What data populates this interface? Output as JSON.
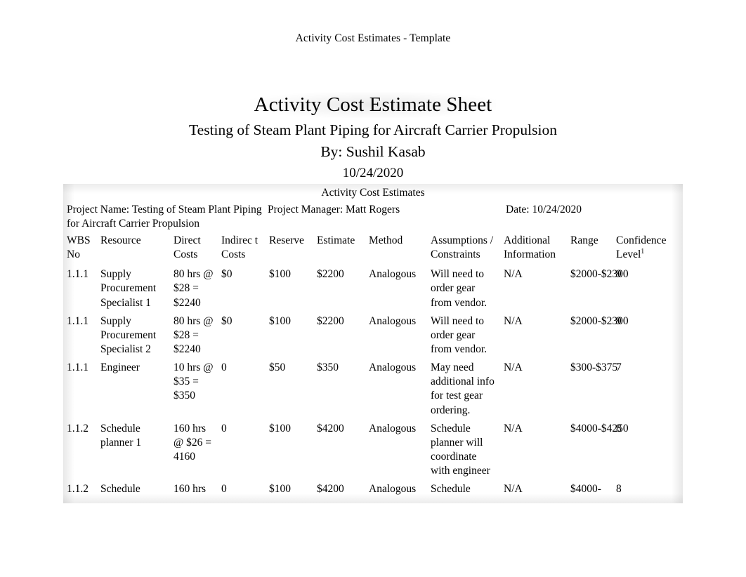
{
  "document": {
    "running_header": "Activity Cost Estimates - Template",
    "title": "Activity Cost Estimate Sheet",
    "subtitle": "Testing of Steam Plant Piping for Aircraft Carrier Propulsion",
    "author_line": "By: Sushil Kasab",
    "date_line": "10/24/2020"
  },
  "table": {
    "caption": "Activity Cost Estimates",
    "info": {
      "project_name": "Project Name: Testing of Steam Plant Piping for Aircraft Carrier Propulsion",
      "project_manager": "Project Manager: Matt Rogers",
      "date": "Date: 10/24/2020"
    },
    "headers": {
      "wbs_no": "WBS No",
      "resource": "Resource",
      "direct_costs": "Direct Costs",
      "indirect_costs": "Indirec t Costs",
      "reserve": "Reserve",
      "estimate": "Estimate",
      "method": "Method",
      "assumptions": "Assumptions / Constraints",
      "additional_information": "Additional Information",
      "range": "Range",
      "confidence_level": "Confidence Level",
      "confidence_level_footnote": "1"
    },
    "rows": [
      {
        "wbs_no": "1.1.1",
        "resource": "Supply Procurement Specialist 1",
        "direct_costs": "80 hrs @ $28 = $2240",
        "indirect_costs": "$0",
        "reserve": "$100",
        "estimate": "$2200",
        "method": "Analogous",
        "assumptions": "Will need to order gear from vendor.",
        "additional_information": "N/A",
        "range": "$2000-$2300",
        "confidence_level": "9"
      },
      {
        "wbs_no": "1.1.1",
        "resource": "Supply Procurement Specialist 2",
        "direct_costs": "80 hrs @ $28 = $2240",
        "indirect_costs": "$0",
        "reserve": "$100",
        "estimate": "$2200",
        "method": "Analogous",
        "assumptions": "Will need to order gear from vendor.",
        "additional_information": "N/A",
        "range": "$2000-$2300",
        "confidence_level": "9"
      },
      {
        "wbs_no": "1.1.1",
        "resource": "Engineer",
        "direct_costs": "10 hrs @ $35 = $350",
        "indirect_costs": "0",
        "reserve": "$50",
        "estimate": "$350",
        "method": "Analogous",
        "assumptions": "May need additional info for test gear ordering.",
        "additional_information": "N/A",
        "range": "$300-$375",
        "confidence_level": "7"
      },
      {
        "wbs_no": "1.1.2",
        "resource": "Schedule planner 1",
        "direct_costs": "160 hrs @ $26 = 4160",
        "indirect_costs": "0",
        "reserve": "$100",
        "estimate": "$4200",
        "method": "Analogous",
        "assumptions": "Schedule planner will coordinate with engineer",
        "additional_information": "N/A",
        "range": "$4000-$4250",
        "confidence_level": "8"
      },
      {
        "wbs_no": "1.1.2",
        "resource": "Schedule",
        "direct_costs": "160 hrs",
        "indirect_costs": "0",
        "reserve": "$100",
        "estimate": "$4200",
        "method": "Analogous",
        "assumptions": "Schedule",
        "additional_information": "N/A",
        "range": "$4000-",
        "confidence_level": "8"
      }
    ]
  }
}
